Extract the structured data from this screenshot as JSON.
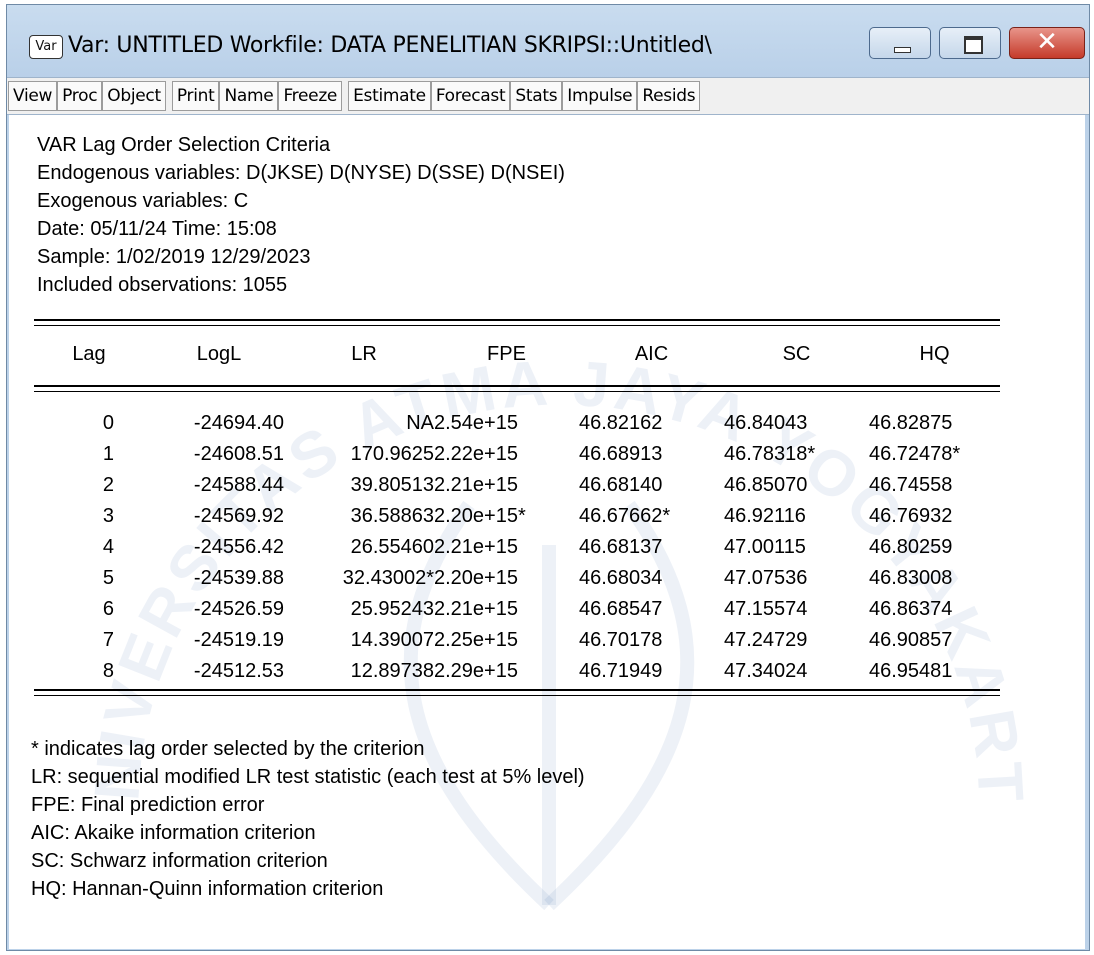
{
  "window": {
    "icon_label": "Var",
    "title": "Var: UNTITLED   Workfile: DATA PENELITIAN SKRIPSI::Untitled\\"
  },
  "toolbar": {
    "buttons": [
      "View",
      "Proc",
      "Object",
      "Print",
      "Name",
      "Freeze",
      "Estimate",
      "Forecast",
      "Stats",
      "Impulse",
      "Resids"
    ]
  },
  "header": {
    "title": "VAR Lag Order Selection Criteria",
    "endogenous": "Endogenous variables: D(JKSE) D(NYSE) D(SSE) D(NSEI) ",
    "exogenous": "Exogenous variables: C ",
    "date": "Date: 05/11/24   Time: 15:08",
    "sample": "Sample: 1/02/2019 12/29/2023",
    "observations": "Included observations: 1055"
  },
  "table": {
    "columns": [
      "Lag",
      "LogL",
      "LR",
      "FPE",
      "AIC",
      "SC",
      "HQ"
    ],
    "rows": [
      [
        "0",
        "-24694.40",
        "NA",
        "2.54e+15",
        "46.82162",
        "46.84043",
        "46.82875"
      ],
      [
        "1",
        "-24608.51",
        "170.9625",
        "2.22e+15",
        "46.68913",
        "46.78318*",
        "46.72478*"
      ],
      [
        "2",
        "-24588.44",
        "39.80513",
        "2.21e+15",
        "46.68140",
        "46.85070",
        "46.74558"
      ],
      [
        "3",
        "-24569.92",
        "36.58863",
        "2.20e+15*",
        "46.67662*",
        "46.92116",
        "46.76932"
      ],
      [
        "4",
        "-24556.42",
        "26.55460",
        "2.21e+15",
        "46.68137",
        "47.00115",
        "46.80259"
      ],
      [
        "5",
        "-24539.88",
        "32.43002*",
        "2.20e+15",
        "46.68034",
        "47.07536",
        "46.83008"
      ],
      [
        "6",
        "-24526.59",
        "25.95243",
        "2.21e+15",
        "46.68547",
        "47.15574",
        "46.86374"
      ],
      [
        "7",
        "-24519.19",
        "14.39007",
        "2.25e+15",
        "46.70178",
        "47.24729",
        "46.90857"
      ],
      [
        "8",
        "-24512.53",
        "12.89738",
        "2.29e+15",
        "46.71949",
        "47.34024",
        "46.95481"
      ]
    ]
  },
  "footnotes": [
    " * indicates lag order selected by the criterion",
    " LR: sequential modified LR test statistic (each test at 5% level)",
    " FPE: Final prediction error",
    " AIC: Akaike information criterion",
    " SC: Schwarz information criterion",
    " HQ: Hannan-Quinn information criterion"
  ],
  "watermark": {
    "text": "UNIVERSITAS ATMA JAYA YOGYAKARTA",
    "color": "#1f4f96"
  }
}
